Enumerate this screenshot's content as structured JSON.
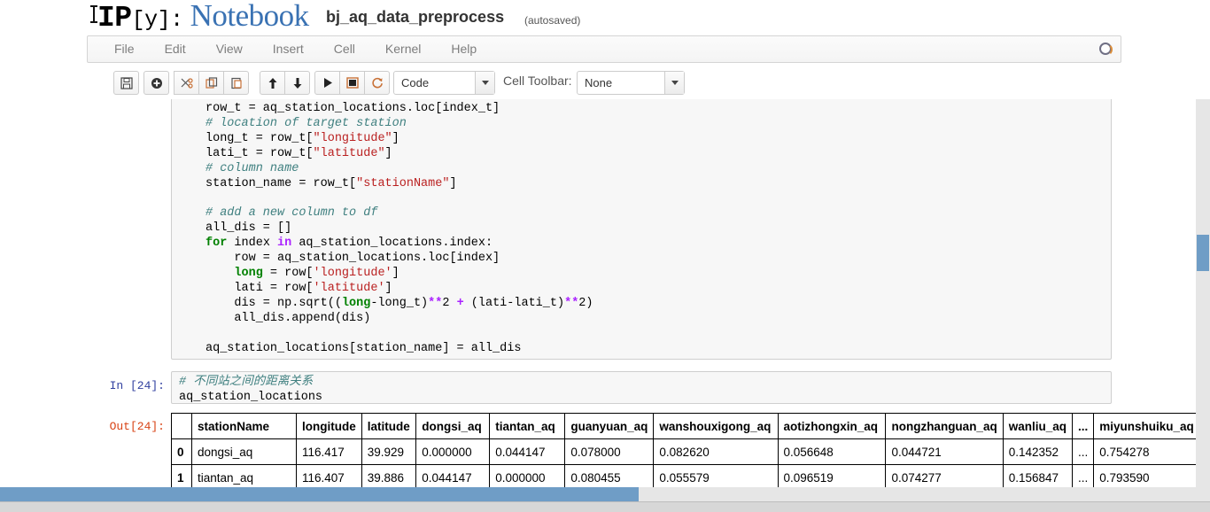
{
  "header": {
    "logo_ip": "IP",
    "logo_brackets": "[y]:",
    "logo_notebook": "Notebook",
    "notebook_name": "bj_aq_data_preprocess",
    "save_status": "(autosaved)"
  },
  "menubar": {
    "items": [
      {
        "label": "File"
      },
      {
        "label": "Edit"
      },
      {
        "label": "View"
      },
      {
        "label": "Insert"
      },
      {
        "label": "Cell"
      },
      {
        "label": "Kernel"
      },
      {
        "label": "Help"
      }
    ],
    "kernel_indicator": "kernel-idle-circle"
  },
  "toolbar": {
    "buttons": [
      {
        "name": "save-button",
        "icon": "floppy-disk-icon",
        "title": "Save and Checkpoint"
      },
      {
        "name": "insert-cell-below-button",
        "icon": "plus-circle-icon",
        "title": "Insert Cell Below"
      },
      {
        "name": "cut-cell-button",
        "icon": "scissors-icon",
        "title": "Cut Cell"
      },
      {
        "name": "copy-cell-button",
        "icon": "copy-icon",
        "title": "Copy Cell"
      },
      {
        "name": "paste-cell-button",
        "icon": "paste-icon",
        "title": "Paste Cell Below"
      },
      {
        "name": "move-cell-up-button",
        "icon": "arrow-up-icon",
        "title": "Move Cell Up"
      },
      {
        "name": "move-cell-down-button",
        "icon": "arrow-down-icon",
        "title": "Move Cell Down"
      },
      {
        "name": "run-cell-button",
        "icon": "play-icon",
        "title": "Run Cell"
      },
      {
        "name": "interrupt-kernel-button",
        "icon": "stop-square-icon",
        "title": "Interrupt Kernel"
      },
      {
        "name": "restart-kernel-button",
        "icon": "restart-circular-arrow-icon",
        "title": "Restart Kernel"
      }
    ],
    "cell_type_value": "Code",
    "cell_toolbar_label": "Cell Toolbar:",
    "cell_toolbar_value": "None"
  },
  "notebook": {
    "cells": [
      {
        "type": "code",
        "prompt": "",
        "code_lines": [
          "row_t = aq_station_locations.loc[index_t]",
          "# location of target station",
          "long_t = row_t[\"longitude\"]",
          "lati_t = row_t[\"latitude\"]",
          "# column name",
          "station_name = row_t[\"stationName\"]",
          "",
          "# add a new column to df",
          "all_dis = []",
          "for index in aq_station_locations.index:",
          "    row = aq_station_locations.loc[index]",
          "    long = row['longitude']",
          "    lati = row['latitude']",
          "    dis = np.sqrt((long-long_t)**2 + (lati-lati_t)**2)",
          "    all_dis.append(dis)",
          "",
          "aq_station_locations[station_name] = all_dis"
        ]
      },
      {
        "type": "code",
        "prompt": "In [24]:",
        "code_lines": [
          "# 不同站之间的距离关系",
          "aq_station_locations"
        ]
      },
      {
        "type": "output",
        "prompt": "Out[24]:"
      }
    ]
  },
  "output_table": {
    "columns": [
      "",
      "stationName",
      "longitude",
      "latitude",
      "dongsi_aq",
      "tiantan_aq",
      "guanyuan_aq",
      "wanshouxigong_aq",
      "aotizhongxin_aq",
      "nongzhanguan_aq",
      "wanliu_aq",
      "...",
      "miyunshuiku_aq"
    ],
    "rows": [
      {
        "index": "0",
        "cells": [
          "dongsi_aq",
          "116.417",
          "39.929",
          "0.000000",
          "0.044147",
          "0.078000",
          "0.082620",
          "0.056648",
          "0.044721",
          "0.142352",
          "...",
          "0.754278"
        ]
      },
      {
        "index": "1",
        "cells": [
          "tiantan_aq",
          "116.407",
          "39.886",
          "0.044147",
          "0.000000",
          "0.080455",
          "0.055579",
          "0.096519",
          "0.074277",
          "0.156847",
          "...",
          "0.793590"
        ]
      }
    ]
  },
  "scrollbars": {
    "vertical_thumb_name": "vertical-scrollbar-thumb",
    "horizontal_thumb_name": "horizontal-scrollbar-thumb",
    "accent_color": "#6f9dc6"
  }
}
